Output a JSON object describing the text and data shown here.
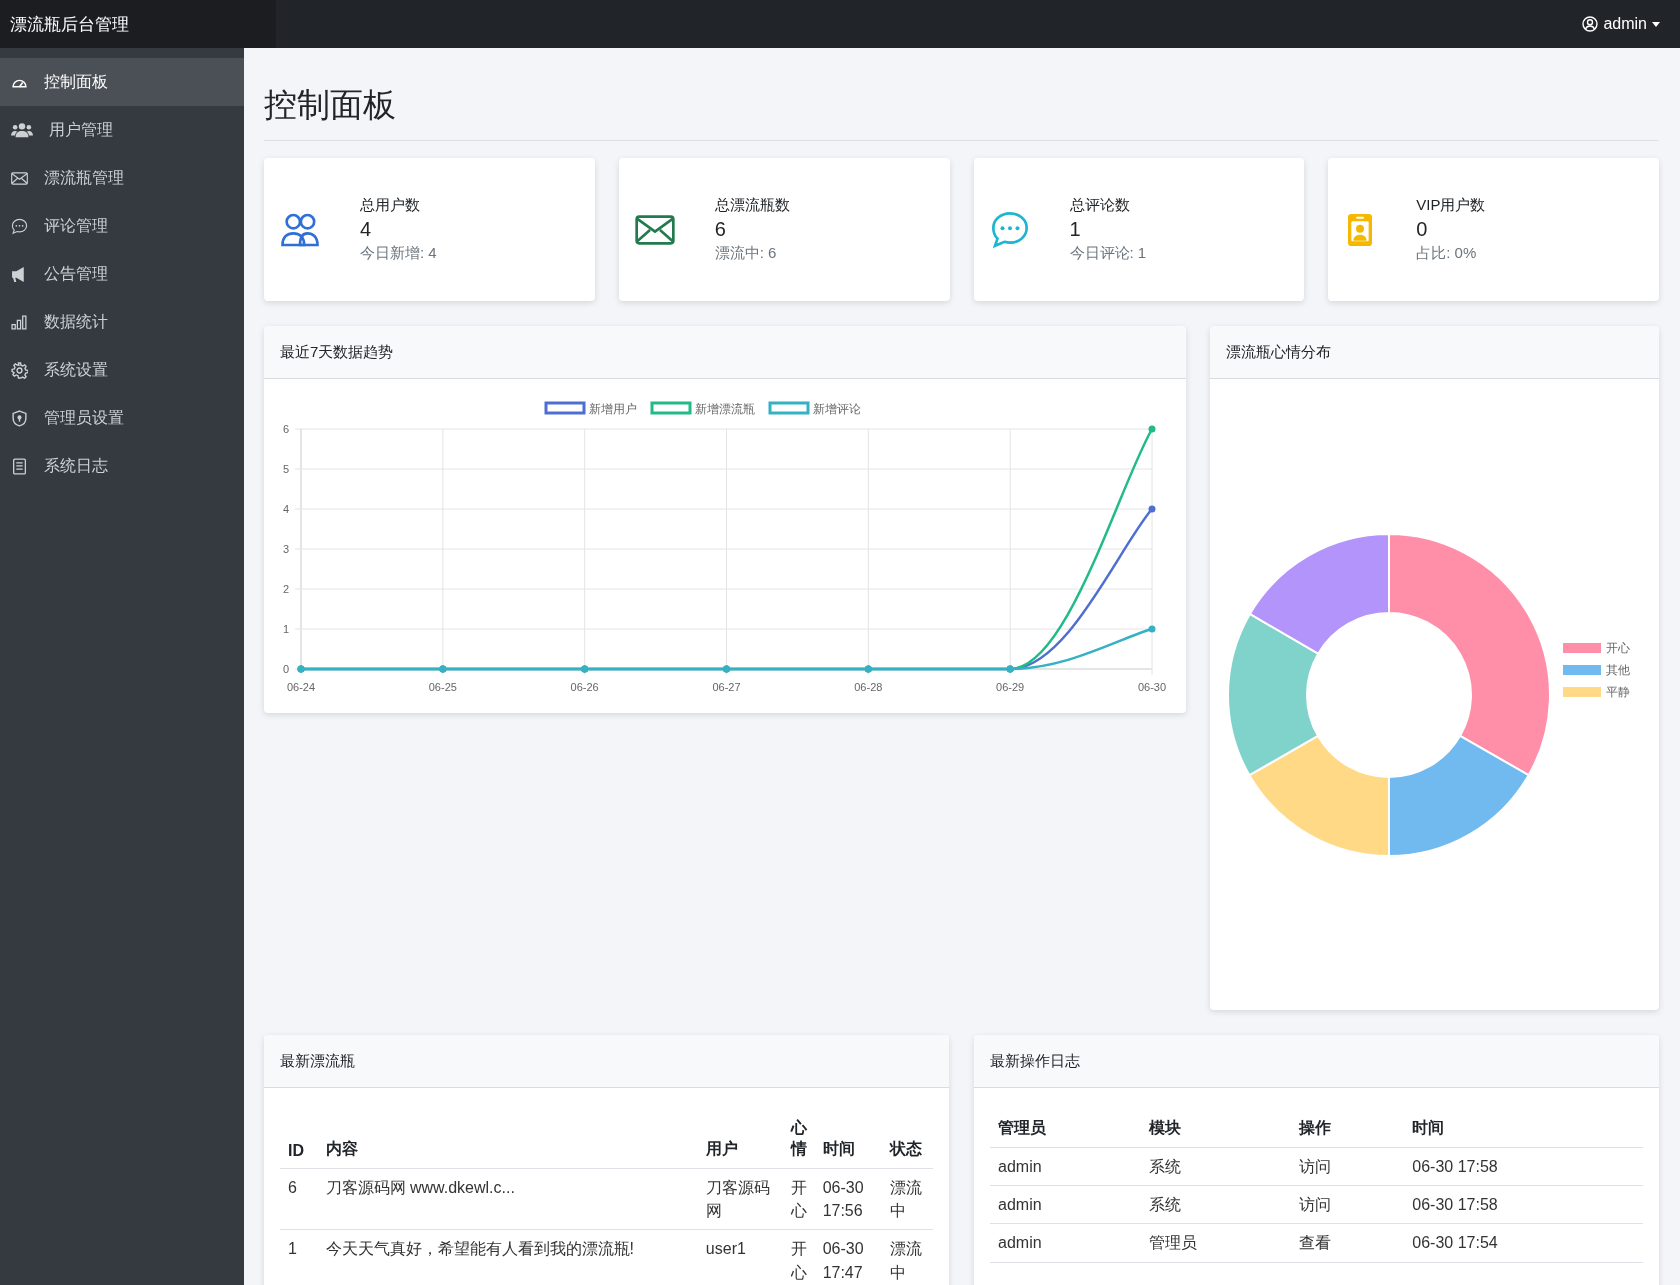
{
  "topbar": {
    "brand": "漂流瓶后台管理",
    "user": "admin"
  },
  "sidebar": {
    "items": [
      {
        "label": "控制面板",
        "selected": true
      },
      {
        "label": "用户管理",
        "selected": false
      },
      {
        "label": "漂流瓶管理",
        "selected": false
      },
      {
        "label": "评论管理",
        "selected": false
      },
      {
        "label": "公告管理",
        "selected": false
      },
      {
        "label": "数据统计",
        "selected": false
      },
      {
        "label": "系统设置",
        "selected": false
      },
      {
        "label": "管理员设置",
        "selected": false
      },
      {
        "label": "系统日志",
        "selected": false
      }
    ]
  },
  "page_title": "控制面板",
  "stats": [
    {
      "color": "#2f6fd6",
      "label": "总用户数",
      "value": "4",
      "sub": "今日新增: 4"
    },
    {
      "color": "#237a4f",
      "label": "总漂流瓶数",
      "value": "6",
      "sub": "漂流中: 6"
    },
    {
      "color": "#1fb5d1",
      "label": "总评论数",
      "value": "1",
      "sub": "今日评论: 1"
    },
    {
      "color": "#f5b800",
      "label": "VIP用户数",
      "value": "0",
      "sub": "占比: 0%"
    }
  ],
  "trend": {
    "title": "最近7天数据趋势",
    "chart_data": {
      "type": "line",
      "categories": [
        "06-24",
        "06-25",
        "06-26",
        "06-27",
        "06-28",
        "06-29",
        "06-30"
      ],
      "yticks": [
        0,
        1,
        2,
        3,
        4,
        5,
        6
      ],
      "ylim": [
        0,
        6
      ],
      "grid": true,
      "legend": true,
      "series": [
        {
          "name": "新增用户",
          "color": "#4e6fd1",
          "marker": "circle",
          "values": [
            0,
            0,
            0,
            0,
            0,
            0,
            4
          ]
        },
        {
          "name": "新增漂流瓶",
          "color": "#22bb88",
          "marker": "circle",
          "values": [
            0,
            0,
            0,
            0,
            0,
            0,
            6
          ]
        },
        {
          "name": "新增评论",
          "color": "#36b1c4",
          "marker": "circle",
          "values": [
            0,
            0,
            0,
            0,
            0,
            0,
            1
          ]
        }
      ]
    }
  },
  "mood": {
    "title": "漂流瓶心情分布",
    "chart_data": {
      "type": "donut",
      "values": [
        33.3,
        16.7,
        16.7,
        16.7,
        16.6
      ]
    },
    "legend": [
      {
        "label": "开心",
        "color": "#ff8fa8"
      },
      {
        "label": "其他",
        "color": "#70baf0"
      },
      {
        "label": "平静",
        "color": "#ffd985"
      }
    ]
  },
  "bottles": {
    "title": "最新漂流瓶",
    "columns": [
      "ID",
      "内容",
      "用户",
      "心情",
      "时间",
      "状态"
    ],
    "rows": [
      [
        "6",
        "刀客源码网 www.dkewl.c...",
        "刀客源码网",
        "开心",
        "06-30 17:56",
        "漂流中"
      ],
      [
        "1",
        "今天天气真好，希望能有人看到我的漂流瓶!",
        "user1",
        "开心",
        "06-30 17:47",
        "漂流中"
      ]
    ]
  },
  "logs": {
    "title": "最新操作日志",
    "columns": [
      "管理员",
      "模块",
      "操作",
      "时间"
    ],
    "rows": [
      [
        "admin",
        "系统",
        "访问",
        "06-30 17:58"
      ],
      [
        "admin",
        "系统",
        "访问",
        "06-30 17:58"
      ],
      [
        "admin",
        "管理员",
        "查看",
        "06-30 17:54"
      ]
    ]
  }
}
